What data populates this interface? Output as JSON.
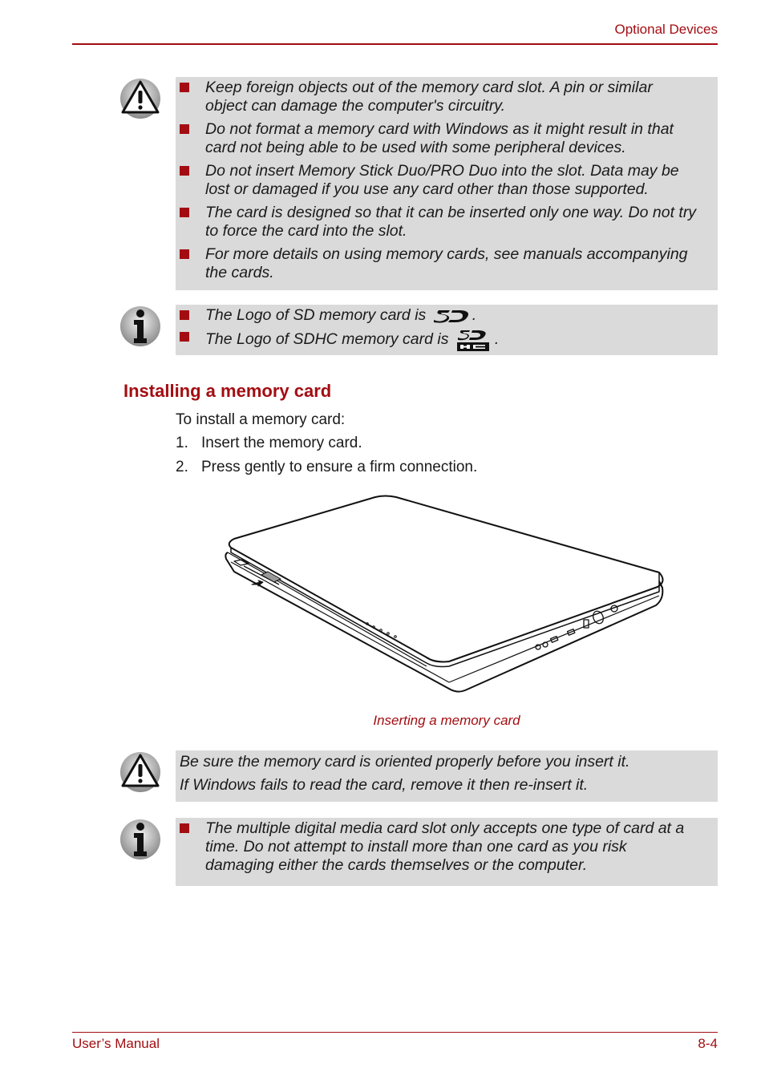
{
  "header": {
    "section_title": "Optional Devices"
  },
  "caution_box_1": {
    "icon": "warning-icon",
    "items": [
      {
        "line1": "Keep foreign objects out of the memory card slot. A pin or similar",
        "line2": "object can damage the computer's circuitry."
      },
      {
        "line1": "Do not format a memory card with Windows as it might result in that",
        "line2": "card not being able to be used with some peripheral devices."
      },
      {
        "line1": "Do not insert Memory Stick Duo/PRO Duo into the slot. Data may be",
        "line2": "lost or damaged if you use any card other than those supported."
      },
      {
        "line1": "The card is designed so that it can be inserted only one way. Do not try",
        "line2": "to force the card into the slot."
      },
      {
        "line1": "For more details on using memory cards, see manuals accompanying",
        "line2": "the cards."
      }
    ]
  },
  "info_box_1": {
    "icon": "info-icon",
    "items": [
      {
        "text": "The Logo of SD memory card is",
        "logo": "sd-logo-icon",
        "end": "."
      },
      {
        "text": "The Logo of SDHC memory card is",
        "logo": "sdhc-logo-icon",
        "end": "."
      }
    ]
  },
  "section": {
    "heading": "Installing a memory card",
    "intro": "To install a memory card:",
    "steps": [
      {
        "num": "1.",
        "text": "Insert the memory card."
      },
      {
        "num": "2.",
        "text": "Press gently to ensure a firm connection."
      }
    ]
  },
  "figure": {
    "illustration": "laptop-memory-card-insertion",
    "caption": "Inserting a memory card"
  },
  "caution_box_2": {
    "icon": "warning-icon",
    "lines": [
      "Be sure the memory card is oriented properly before you insert it.",
      "If Windows fails to read the card, remove it then re-insert it."
    ]
  },
  "info_box_2": {
    "icon": "info-icon",
    "items": [
      {
        "line1": "The multiple digital media card slot only accepts one type of card at a",
        "line2": "time. Do not attempt to install more than one card as you risk",
        "line3": "damaging either the cards themselves or the computer."
      }
    ]
  },
  "footer": {
    "left": "User’s Manual",
    "right": "8-4"
  },
  "colors": {
    "accent": "#a30d12",
    "note_bg": "#dadada"
  }
}
